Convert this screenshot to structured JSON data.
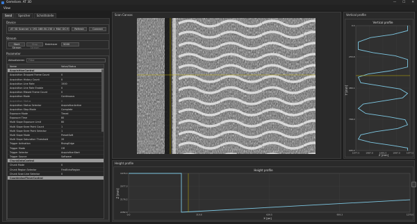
{
  "window": {
    "title": "Gemstore. AT 3D",
    "controls": [
      "—",
      "☐",
      "✕"
    ]
  },
  "menu": {
    "view": "View"
  },
  "tabs": [
    {
      "label": "Send"
    },
    {
      "label": "Speicher"
    },
    {
      "label": "Schnittstelle"
    }
  ],
  "device": {
    "title": "Device",
    "selection": "AT 3D Scanner < 192.168.50.230 > MAC DC:91:B4 >",
    "refresh": "Refresh",
    "connect": "Connect"
  },
  "stream": {
    "title": "Stream",
    "start": "Start Stream",
    "stop": "Stop Stream",
    "batchsize_label": "Batchsize",
    "batchsize_value": "5000"
  },
  "parameters": {
    "title": "Parameter",
    "filter_label": "Aktualisieren",
    "filter_value": "Filter",
    "columns": {
      "name": "Name",
      "value": "Value/Status"
    },
    "rows": [
      {
        "name": "AcquisitionControl",
        "value": "",
        "type": "cat"
      },
      {
        "name": "Acquisition Dropped Frame Count",
        "value": "0"
      },
      {
        "name": "Acquisition History Count",
        "value": "0"
      },
      {
        "name": "Acquisition Line Rate",
        "value": "1500"
      },
      {
        "name": "Acquisition Line Rate Enable",
        "value": "0"
      },
      {
        "name": "Acquisition Missed Frame Count",
        "value": "0"
      },
      {
        "name": "Acquisition Mode",
        "value": "Continuous"
      },
      {
        "name": "Acquisition Status",
        "value": "0",
        "type": "disabled"
      },
      {
        "name": "Acquisition Status Selector",
        "value": "AcquisitionActive"
      },
      {
        "name": "Acquisition Stop Mode",
        "value": "Complete"
      },
      {
        "name": "Exposure Mode",
        "value": "Timed"
      },
      {
        "name": "Exposure Time",
        "value": "80"
      },
      {
        "name": "Multi Slope Exposure Limit",
        "value": "80"
      },
      {
        "name": "Multi Slope Knee Point Count",
        "value": "1"
      },
      {
        "name": "Multi Slope Knee Point Selector",
        "value": "1"
      },
      {
        "name": "Multi Slope Mode",
        "value": "PresetSoft"
      },
      {
        "name": "Multi Slope Saturation Threshold",
        "value": "20"
      },
      {
        "name": "Trigger Activation",
        "value": "RisingEdge"
      },
      {
        "name": "Trigger Mode",
        "value": "Off"
      },
      {
        "name": "Trigger Selector",
        "value": "AcquisitionStart"
      },
      {
        "name": "Trigger Source",
        "value": "Software"
      },
      {
        "name": "ChunkDataControl",
        "value": "",
        "type": "cat"
      },
      {
        "name": "Chunk Mode",
        "value": "0"
      },
      {
        "name": "Chunk Region Selector",
        "value": "FirstEchoRegion"
      },
      {
        "name": "Chunk Scan Line Selector",
        "value": "0"
      },
      {
        "name": "CounterAndTimerControl",
        "value": "",
        "type": "cat"
      }
    ]
  },
  "scan_canvas": {
    "title": "Scan Canvas"
  },
  "vertical_profile": {
    "panel_title": "Vertical profile",
    "chart_title": "Vertical profile",
    "xlabel": "Z [mm]",
    "ylabel": "Y [mm]",
    "xticks": [
      "1977.5",
      "1987.0",
      "1991.5",
      "1997.0",
      "1977.0"
    ],
    "yticks": [
      "0.0",
      "255.8",
      "480.1",
      "768.0",
      "995.0"
    ]
  },
  "height_profile": {
    "panel_title": "Height profile",
    "chart_title": "Height profile",
    "xlabel": "X [px]",
    "ylabel": "Z [mm]",
    "xticks": [
      "0.0",
      "319.8",
      "639.5",
      "959.3",
      "1279.0"
    ],
    "yticks": [
      "2282.0",
      "2176.2",
      "2077.3",
      "1976.0"
    ]
  },
  "colors": {
    "accent": "#7ec8e3",
    "cursor": "#c8b400",
    "category_row": "#9a9a9a"
  },
  "chart_data": [
    {
      "type": "line",
      "title": "Vertical profile",
      "xlabel": "Z [mm]",
      "ylabel": "Y [mm]",
      "xlim": [
        1977.0,
        1999.0
      ],
      "ylim": [
        0,
        995
      ],
      "series": [
        {
          "x": [
            1998,
            1998,
            1992,
            1983,
            1978,
            1978,
            1984,
            1993,
            1998,
            1998,
            1991,
            1982,
            1978,
            1979,
            1987,
            1995,
            1998,
            1996,
            1988,
            1980,
            1978,
            1981,
            1990,
            1997,
            1998,
            1994,
            1985,
            1979,
            1978,
            1983,
            1992,
            1998,
            1998
          ],
          "y": [
            0,
            40,
            70,
            95,
            130,
            190,
            215,
            240,
            270,
            330,
            360,
            385,
            410,
            455,
            480,
            505,
            540,
            575,
            600,
            625,
            660,
            700,
            725,
            750,
            790,
            820,
            845,
            870,
            905,
            930,
            955,
            975,
            995
          ]
        }
      ]
    },
    {
      "type": "line",
      "title": "Height profile",
      "xlabel": "X [px]",
      "ylabel": "Z [mm]",
      "xlim": [
        0,
        1279
      ],
      "ylim": [
        1976.0,
        2282.0
      ],
      "series": [
        {
          "x": [
            0,
            240,
            240,
            1279
          ],
          "y": [
            2282.0,
            2282.0,
            1976.0,
            2074.0
          ]
        }
      ]
    }
  ]
}
